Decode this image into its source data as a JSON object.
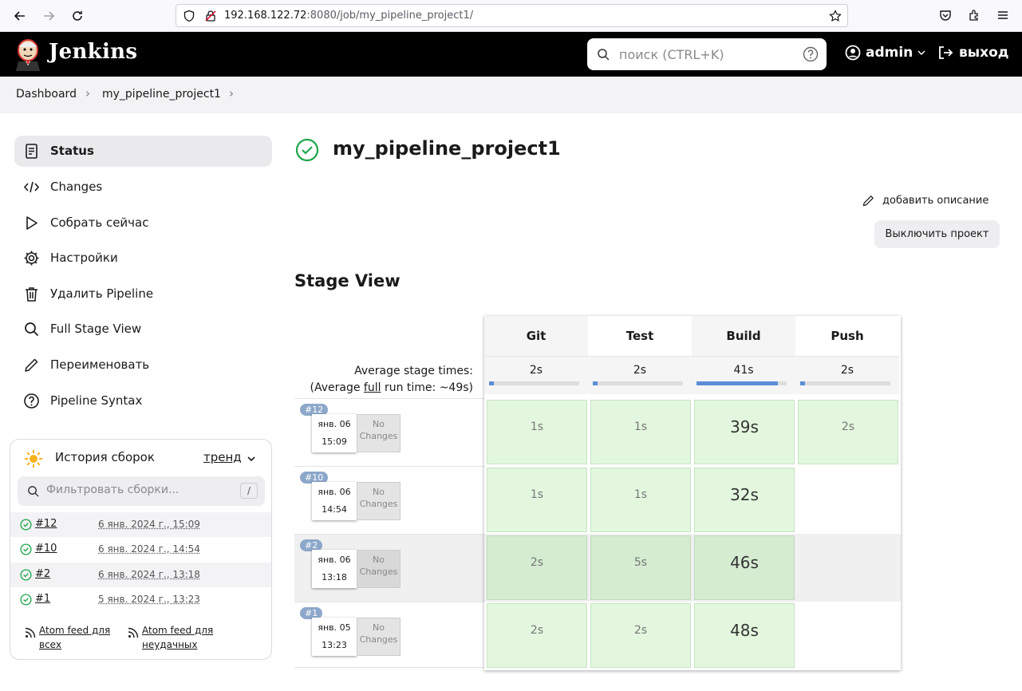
{
  "browser": {
    "url_host": "192.168.122.72",
    "url_rest": ":8080/job/my_pipeline_project1/"
  },
  "header": {
    "title": "Jenkins",
    "search_placeholder": "поиск (CTRL+K)",
    "user": "admin",
    "logout": "выход"
  },
  "breadcrumb": [
    "Dashboard",
    "my_pipeline_project1"
  ],
  "sidebar": {
    "items": [
      {
        "label": "Status",
        "icon": "status-icon"
      },
      {
        "label": "Changes",
        "icon": "code-icon"
      },
      {
        "label": "Собрать сейчас",
        "icon": "play-icon"
      },
      {
        "label": "Настройки",
        "icon": "gear-icon"
      },
      {
        "label": "Удалить Pipeline",
        "icon": "trash-icon"
      },
      {
        "label": "Full Stage View",
        "icon": "search-icon"
      },
      {
        "label": "Переименовать",
        "icon": "pencil-icon"
      },
      {
        "label": "Pipeline Syntax",
        "icon": "help-icon"
      }
    ]
  },
  "history": {
    "title": "История сборок",
    "trend": "тренд",
    "filter_placeholder": "Фильтровать сборки...",
    "filter_shortcut": "/",
    "builds": [
      {
        "num": "#12",
        "date": "6 янв. 2024 г., 15:09"
      },
      {
        "num": "#10",
        "date": "6 янв. 2024 г., 14:54"
      },
      {
        "num": "#2",
        "date": "6 янв. 2024 г., 13:18"
      },
      {
        "num": "#1",
        "date": "5 янв. 2024 г., 13:23"
      }
    ],
    "feed_all": "Atom feed для всех",
    "feed_failed": "Atom feed для неудачных"
  },
  "main": {
    "title": "my_pipeline_project1",
    "add_description": "добавить описание",
    "disable_project": "Выключить проект",
    "stage_view_title": "Stage View",
    "avg_label_1": "Average stage times:",
    "avg_label_2_prefix": "(Average ",
    "avg_label_2_link": "full",
    "avg_label_2_suffix": " run time: ~49s)"
  },
  "stage_view": {
    "stages": [
      "Git",
      "Test",
      "Build",
      "Push"
    ],
    "averages": [
      "2s",
      "2s",
      "41s",
      "2s"
    ],
    "avg_fill_fraction": [
      0.05,
      0.05,
      0.9,
      0.05
    ],
    "no_changes": "No Changes",
    "runs": [
      {
        "badge": "#12",
        "date": "янв. 06",
        "time": "15:09",
        "durations": [
          "1s",
          "1s",
          "39s",
          "2s"
        ]
      },
      {
        "badge": "#10",
        "date": "янв. 06",
        "time": "14:54",
        "durations": [
          "1s",
          "1s",
          "32s",
          ""
        ]
      },
      {
        "badge": "#2",
        "date": "янв. 06",
        "time": "13:18",
        "durations": [
          "2s",
          "5s",
          "46s",
          ""
        ]
      },
      {
        "badge": "#1",
        "date": "янв. 05",
        "time": "13:23",
        "durations": [
          "2s",
          "2s",
          "48s",
          ""
        ]
      }
    ]
  }
}
